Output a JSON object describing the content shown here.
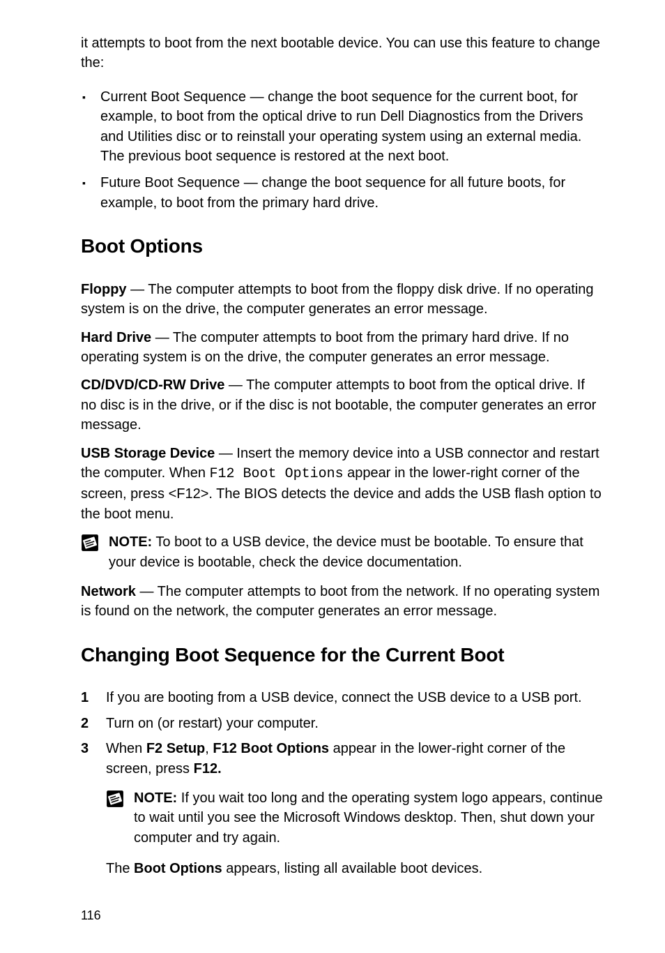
{
  "intro": "it attempts to boot from the next bootable device. You can use this feature to change the:",
  "bullets": [
    "Current Boot Sequence — change the boot sequence for the current boot, for example, to boot from the optical drive to run Dell Diagnostics from the Drivers and Utilities disc or to reinstall your operating system using an external media. The previous boot sequence is restored at the next boot.",
    "Future Boot Sequence — change the boot sequence for all future boots, for example, to boot from the primary hard drive."
  ],
  "heading_boot_options": "Boot Options",
  "floppy": {
    "label": "Floppy",
    "text": " — The computer attempts to boot from the floppy disk drive. If no operating system is on the drive, the computer generates an error message."
  },
  "hard_drive": {
    "label": "Hard Drive",
    "text": " — The computer attempts to boot from the primary hard drive. If no operating system is on the drive, the computer generates an error message."
  },
  "cddvd": {
    "label": "CD/DVD/CD-RW Drive",
    "text": " — The computer attempts to boot from the optical drive. If no disc is in the drive, or if the disc is not bootable, the computer generates an error message."
  },
  "usb_storage": {
    "label": "USB Storage Device",
    "text_1": " — Insert the memory device into a USB connector and restart the computer. When ",
    "mono": "F12 Boot Options",
    "text_2": " appear in the lower-right corner of the screen, press <F12>. The BIOS detects the device and adds the USB flash option to the boot menu."
  },
  "note_usb": {
    "label": "NOTE:",
    "text": " To boot to a USB device, the device must be bootable. To ensure that your device is bootable, check the device documentation."
  },
  "network": {
    "label": "Network",
    "text": " — The computer attempts to boot from the network. If no operating system is found on the network, the computer generates an error message."
  },
  "heading_changing": "Changing Boot Sequence for the Current Boot",
  "steps": {
    "s1_num": "1",
    "s1_text": "If you are booting from a USB device, connect the USB device to a USB port.",
    "s2_num": "2",
    "s2_text": "Turn on (or restart) your computer.",
    "s3_num": "3",
    "s3_pre": "When ",
    "s3_b1": "F2 Setup",
    "s3_mid": ", ",
    "s3_b2": "F12 Boot Options",
    "s3_post": " appear in the lower-right corner of the screen, press ",
    "s3_b3": "F12.",
    "s3_note_label": "NOTE:",
    "s3_note_text": " If you wait too long and the operating system logo appears, continue to wait until you see the Microsoft Windows desktop. Then, shut down your computer and try again.",
    "s3_result_pre": "The ",
    "s3_result_b": "Boot Options",
    "s3_result_post": " appears, listing all available boot devices."
  },
  "page_num": "116"
}
